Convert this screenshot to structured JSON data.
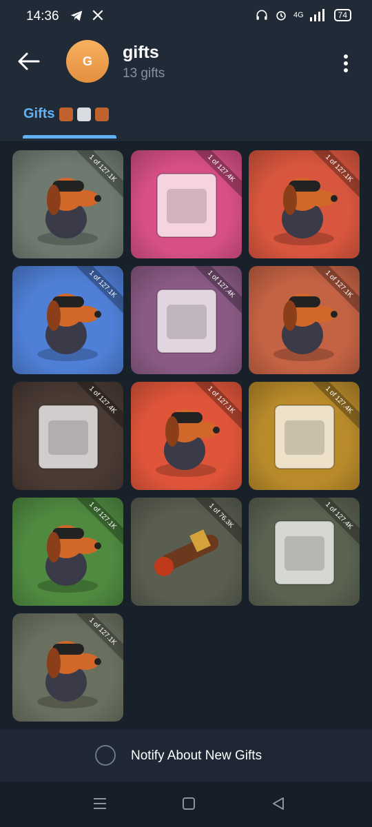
{
  "status": {
    "time": "14:36",
    "network": "4G",
    "battery": "74"
  },
  "header": {
    "avatar_letter": "G",
    "title": "gifts",
    "subtitle": "13 gifts"
  },
  "tabs": [
    {
      "label": "Gifts"
    }
  ],
  "gifts": [
    {
      "ribbon": "1 of 127.1K",
      "bg": "#6e7a70",
      "art": "dog-cap"
    },
    {
      "ribbon": "1 of 127.4K",
      "bg": "#d64f86",
      "art": "smokefest-bag"
    },
    {
      "ribbon": "1 of 127.1K",
      "bg": "#d8563e",
      "art": "dog-afro"
    },
    {
      "ribbon": "1 of 127.1K",
      "bg": "#4f7fd6",
      "art": "bear-dog"
    },
    {
      "ribbon": "1 of 127.4K",
      "bg": "#8a5a84",
      "art": "s-bag"
    },
    {
      "ribbon": "1 of 127.1K",
      "bg": "#c46244",
      "art": "dog-blue-hat"
    },
    {
      "ribbon": "1 of 127.4K",
      "bg": "#4a3a34",
      "art": "bud-bag"
    },
    {
      "ribbon": "1 of 127.1K",
      "bg": "#e0553a",
      "art": "purple-dog"
    },
    {
      "ribbon": "1 of 127.4K",
      "bg": "#b88a2a",
      "art": "chips-bag"
    },
    {
      "ribbon": "1 of 127.1K",
      "bg": "#4f8a40",
      "art": "dog-cap-green"
    },
    {
      "ribbon": "1 of 76.3K",
      "bg": "#5a5e50",
      "art": "cigar"
    },
    {
      "ribbon": "1 of 127.4K",
      "bg": "#5a6250",
      "art": "toast"
    },
    {
      "ribbon": "1 of 127.1K",
      "bg": "#6a7060",
      "art": "dog-headphones"
    }
  ],
  "notify": {
    "label": "Notify About New Gifts"
  },
  "icons": [
    "back-arrow-icon",
    "more-vertical-icon",
    "telegram-icon",
    "x-icon",
    "headphones-icon",
    "alarm-icon",
    "signal-icon",
    "nav-menu-icon",
    "nav-home-icon",
    "nav-back-icon"
  ]
}
